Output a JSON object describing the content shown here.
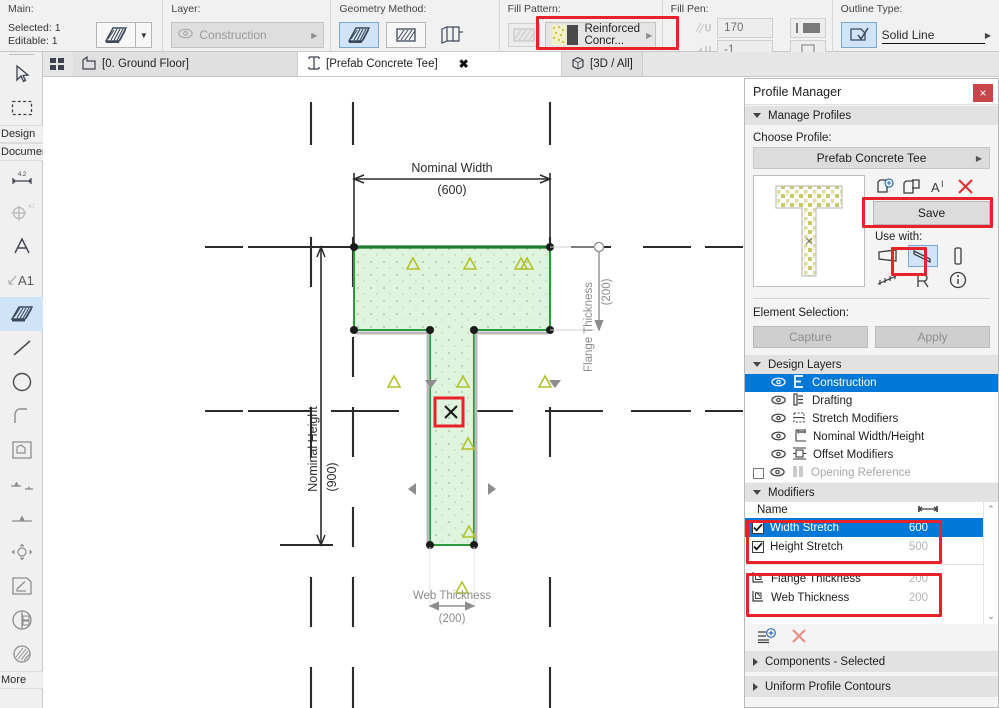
{
  "toolbar": {
    "main": {
      "label": "Main:",
      "selected": "Selected: 1",
      "editable": "Editable: 1",
      "tool_icon": "fill-tool-icon",
      "caret_icon": "chevron-down-icon"
    },
    "layer": {
      "label": "Layer:",
      "value": "Construction",
      "eye_icon": "eye-icon",
      "arrow_icon": "chevron-right-icon"
    },
    "geometry": {
      "label": "Geometry Method:",
      "methods": [
        "polygon-fill-icon",
        "rectangle-fill-icon",
        "slanted-fill-icon"
      ],
      "active_index": 0
    },
    "fill_pattern": {
      "label": "Fill Pattern:",
      "disabled_icon": "hatch-swatch-icon",
      "value": "Reinforced Concr...",
      "arrow_icon": "chevron-right-icon"
    },
    "fill_pen": {
      "label": "Fill Pen:",
      "pen_fg": "170",
      "pen_bg": "-1",
      "fg_icon": "hatch-pen-icon",
      "bg_icon": "background-pen-icon",
      "right_icon_1": "pen-set-icon",
      "right_icon_2": "screen-icon"
    },
    "outline": {
      "label": "Outline Type:",
      "icon": "outline-check-icon",
      "value": "Solid Line",
      "arrow_icon": "chevron-right-icon"
    }
  },
  "left_palette": {
    "items": [
      {
        "icon": "arrow-pointer-icon",
        "label": ""
      },
      {
        "icon": "marquee-icon",
        "label": ""
      },
      {
        "icon": "",
        "label": "Design"
      },
      {
        "icon": "",
        "label": "Documer"
      },
      {
        "icon": "dimension-icon",
        "label": ""
      },
      {
        "icon": "level-dimension-icon",
        "label": ""
      },
      {
        "icon": "text-icon",
        "label": ""
      },
      {
        "icon": "label-a1-icon",
        "label": ""
      },
      {
        "icon": "fill-tool-icon",
        "label": ""
      },
      {
        "icon": "line-icon",
        "label": ""
      },
      {
        "icon": "circle-icon",
        "label": ""
      },
      {
        "icon": "arc-icon",
        "label": ""
      },
      {
        "icon": "polyline-icon",
        "label": ""
      },
      {
        "icon": "section-icon",
        "label": ""
      },
      {
        "icon": "elevation-icon",
        "label": ""
      },
      {
        "icon": "detail-icon",
        "label": ""
      },
      {
        "icon": "worksheet-icon",
        "label": ""
      },
      {
        "icon": "change-marker-icon",
        "label": ""
      },
      {
        "icon": "drawing-icon",
        "label": ""
      },
      {
        "icon": "",
        "label": "More"
      }
    ],
    "active_index": 8
  },
  "tabs": {
    "grid_icon": "tab-grid-icon",
    "items": [
      {
        "label": "[0. Ground Floor]",
        "icon": "floorplan-icon",
        "active": false,
        "closable": false
      },
      {
        "label": "[Prefab Concrete Tee]",
        "icon": "profile-i-icon",
        "active": true,
        "closable": true
      },
      {
        "label": "[3D / All]",
        "icon": "cube-icon",
        "active": false,
        "closable": false
      }
    ],
    "close_glyph": "✖"
  },
  "canvas": {
    "dimensions": {
      "nominal_width": {
        "label": "Nominal Width",
        "value": "(600)"
      },
      "nominal_height": {
        "label": "Nominal Height",
        "value": "(900)"
      },
      "flange_thickness": {
        "label": "Flange Thickness",
        "value": "(200)"
      },
      "web_thickness": {
        "label": "Web Thickness",
        "value": "(200)"
      }
    },
    "colors": {
      "fill": "#dff4dd",
      "outline": "#2c9a3f",
      "guide": "#2b2b2b",
      "dim_gray": "#8c8c8c",
      "modifier_yellow": "#b2c12c",
      "highlight_red": "#e8222a"
    },
    "origin_marker": "origin-x-marker"
  },
  "profile_manager": {
    "title": "Profile Manager",
    "close_glyph": "×",
    "manage_profiles": {
      "label": "Manage Profiles",
      "expanded": true
    },
    "choose_profile_label": "Choose Profile:",
    "profile_name": "Prefab Concrete Tee",
    "actions": {
      "new_icon": "new-profile-icon",
      "duplicate_icon": "duplicate-profile-icon",
      "rename_icon": "rename-profile-icon",
      "delete_icon": "delete-profile-icon",
      "save_label": "Save"
    },
    "use_with": {
      "label": "Use with:",
      "items": [
        {
          "icon": "wall-icon",
          "selected": false
        },
        {
          "icon": "beam-icon",
          "selected": true
        },
        {
          "icon": "column-icon",
          "selected": false
        },
        {
          "icon": "railing-icon",
          "selected": false
        },
        {
          "icon": "object-icon",
          "selected": false
        },
        {
          "icon": "info-icon",
          "selected": false
        }
      ]
    },
    "element_selection": {
      "label": "Element Selection:",
      "capture_label": "Capture",
      "apply_label": "Apply"
    },
    "design_layers": {
      "label": "Design Layers",
      "expanded": true,
      "rows": [
        {
          "name": "Construction",
          "icon": "construction-layer-icon",
          "eye": "eye-icon",
          "selected": true,
          "dim": false,
          "checkbox": false
        },
        {
          "name": "Drafting",
          "icon": "drafting-layer-icon",
          "eye": "eye-icon",
          "selected": false,
          "dim": false,
          "checkbox": false
        },
        {
          "name": "Stretch Modifiers",
          "icon": "stretch-layer-icon",
          "eye": "eye-icon",
          "selected": false,
          "dim": false,
          "checkbox": false
        },
        {
          "name": "Nominal Width/Height",
          "icon": "nominal-layer-icon",
          "eye": "eye-icon",
          "selected": false,
          "dim": false,
          "checkbox": false
        },
        {
          "name": "Offset Modifiers",
          "icon": "offset-layer-icon",
          "eye": "eye-icon",
          "selected": false,
          "dim": false,
          "checkbox": false
        },
        {
          "name": "Opening Reference",
          "icon": "opening-layer-icon",
          "eye": "eye-icon",
          "selected": false,
          "dim": true,
          "checkbox": true
        }
      ]
    },
    "modifiers": {
      "label": "Modifiers",
      "expanded": true,
      "columns": {
        "name": "Name",
        "value_icon": "width-measure-icon"
      },
      "rows": [
        {
          "name": "Width Stretch",
          "value": "600",
          "checkbox": true,
          "checked": true,
          "selected": true,
          "icon": "",
          "dim_value": false
        },
        {
          "name": "Height Stretch",
          "value": "500",
          "checkbox": true,
          "checked": true,
          "selected": false,
          "icon": "",
          "dim_value": true
        },
        {
          "name": "Flange Thickness",
          "value": "200",
          "checkbox": false,
          "checked": false,
          "selected": false,
          "icon": "offset-modifier-icon",
          "dim_value": true
        },
        {
          "name": "Web Thickness",
          "value": "200",
          "checkbox": false,
          "checked": false,
          "selected": false,
          "icon": "offset-modifier-icon",
          "dim_value": true
        }
      ],
      "tools": {
        "add_icon": "add-modifier-icon",
        "remove_icon": "remove-modifier-icon"
      },
      "scroll_up": "⌃",
      "scroll_down": "⌄"
    },
    "components_section": {
      "label": "Components - Selected",
      "expanded": false
    },
    "contours_section": {
      "label": "Uniform Profile Contours",
      "expanded": false
    }
  },
  "highlights": {
    "accent": "#e8222a",
    "selection_blue": "#0078d7",
    "active_tool_blue": "#cfe4f7"
  }
}
